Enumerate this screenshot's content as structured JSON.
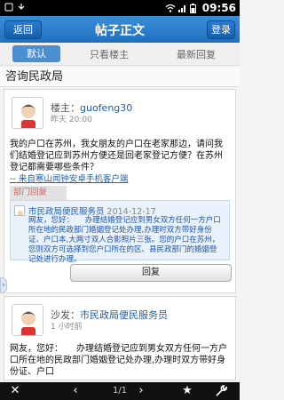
{
  "status_bar": {
    "time": "09:56"
  },
  "header": {
    "back_label": "返回",
    "title": "帖子正文",
    "login_label": "登录"
  },
  "tabs": [
    {
      "label": "默认",
      "active": true
    },
    {
      "label": "只看楼主",
      "active": false
    },
    {
      "label": "最新回复",
      "active": false
    }
  ],
  "thread": {
    "title": "咨询民政局"
  },
  "post1": {
    "user_prefix": "楼主：",
    "username": "guofeng30",
    "time": "昨天 20:00",
    "content": "我的户口在苏州，我女朋友的户口在老家那边，请问我们结婚登记应到苏州方便还是回老家登记方便？在苏州登记都需要哪些条件？",
    "client_link": "-- 来自寒山闻钟安卓手机客户端",
    "reply_section_label": "部门回复",
    "reply": {
      "user": "市民政局便民服务员",
      "date": "2014-12-17",
      "text": "网友，您好：　　办理结婚登记应到男女双方任何一方户口所在地的民政部门婚姻登记处办理,办理时双方带好身份证、户口本,大两寸双人合影照片三张。您的户口在苏州，您则双方可选择到您户口所在的区、县民政部门的婚姻登记处进行办理。"
    },
    "reply_button": "回复"
  },
  "post2": {
    "user_prefix": "沙发：",
    "username": "市民政局便民服务员",
    "time": "1 小时前",
    "content": "网友，您好：　　办理结婚登记应到男女双方任何一方户口所在地的民政部门婚姻登记处办理,办理时双方带好身份证、户口"
  },
  "toolbar": {
    "pager": "1/1"
  },
  "colors": {
    "accent": "#2a7bd0",
    "link": "#1f5fa8"
  }
}
